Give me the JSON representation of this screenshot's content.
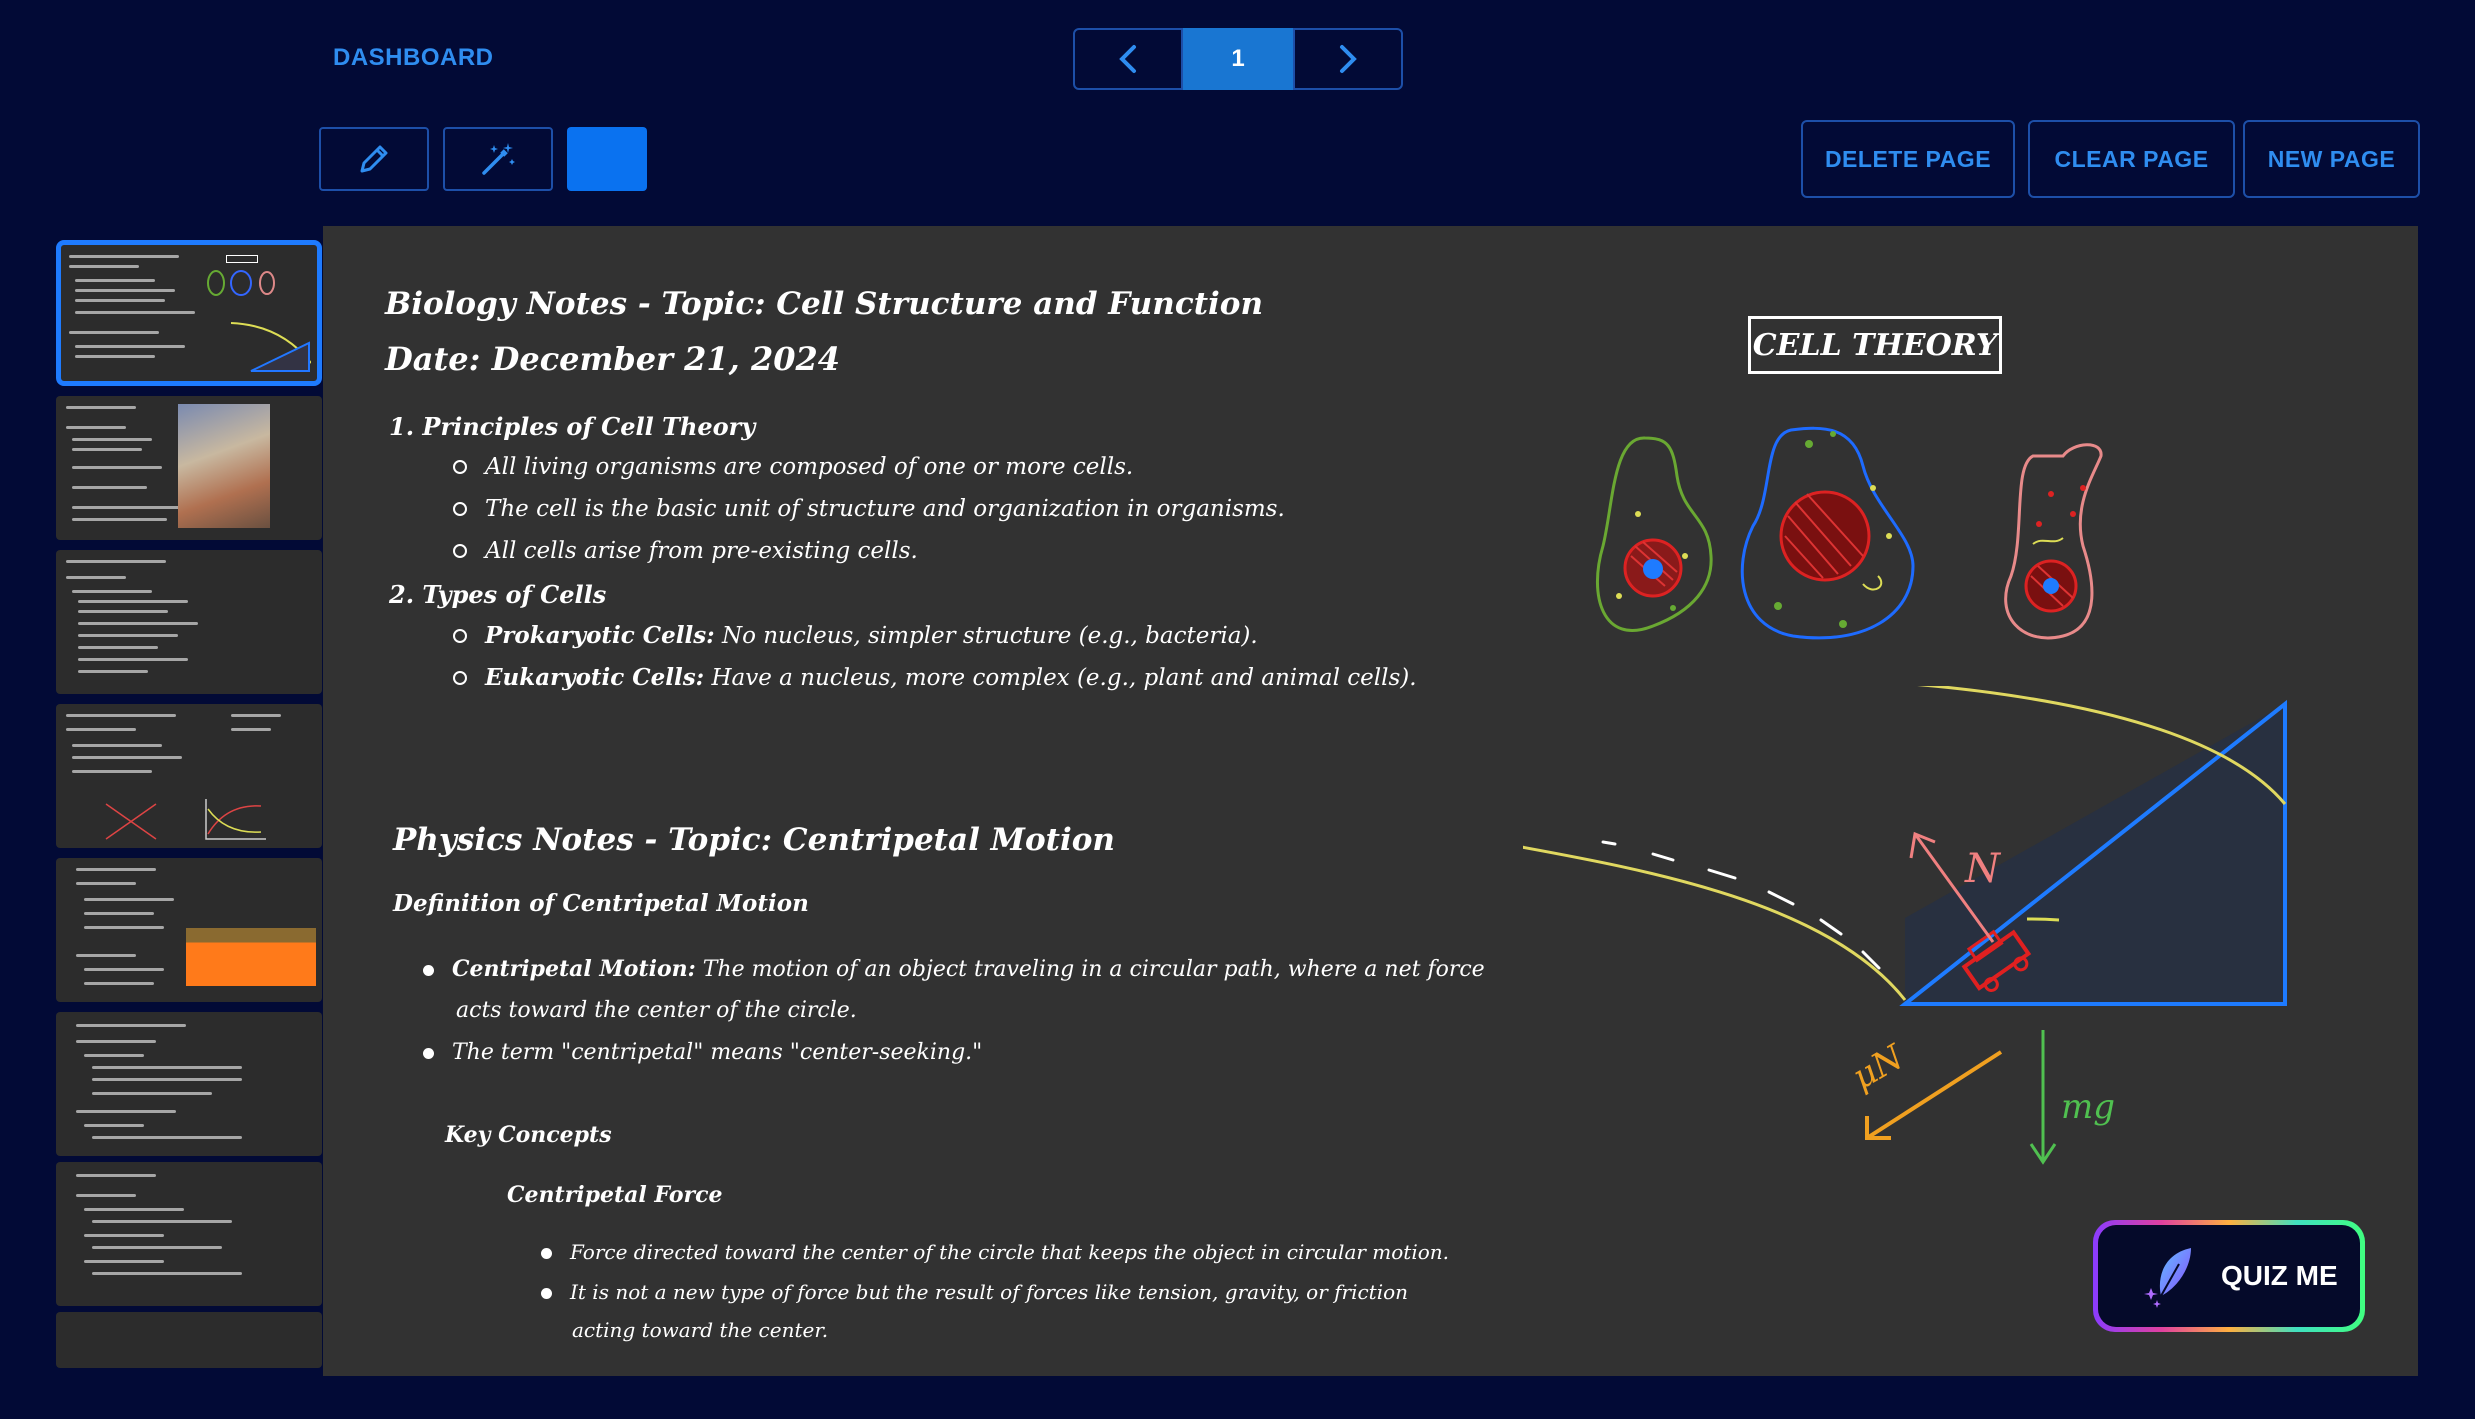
{
  "header": {
    "dashboard_label": "DASHBOARD",
    "page_number": "1"
  },
  "toolbar": {
    "swatch_color": "#0a72f0",
    "delete_page": "DELETE PAGE",
    "clear_page": "CLEAR PAGE",
    "new_page": "NEW PAGE"
  },
  "thumbnails": {
    "count": 8,
    "selected_index": 0
  },
  "biology": {
    "title": "Biology Notes - Topic: Cell Structure and Function",
    "date": "Date: December 21, 2024",
    "section1_heading": "1.  Principles of Cell Theory",
    "section1_items": [
      "All living organisms are composed of one or more cells.",
      "The cell is the basic unit of structure and organization in organisms.",
      "All cells arise from pre-existing cells."
    ],
    "section2_heading": "2.  Types of Cells",
    "prok_label": "Prokaryotic Cells:",
    "prok_text": " No nucleus, simpler structure (e.g., bacteria).",
    "euk_label": "Eukaryotic Cells:",
    "euk_text": " Have a nucleus, more complex (e.g., plant and animal cells).",
    "cell_theory_label": "CELL THEORY"
  },
  "physics": {
    "title": "Physics Notes - Topic: Centripetal Motion",
    "definition_heading": "Definition of Centripetal Motion",
    "cm_label": "Centripetal Motion:",
    "cm_text_1": " The motion of an object traveling in a circular path, where a net force",
    "cm_text_2": "acts toward the center of the circle.",
    "term_text": "The term \"centripetal\" means \"center-seeking.\"",
    "key_concepts": "Key Concepts",
    "cf_heading": "Centripetal Force",
    "cf_items": [
      "Force directed toward the center of the circle that keeps the object in circular motion.",
      "It is not a new type of force but the result of forces like tension, gravity, or friction"
    ],
    "cf_item2_cont": "acting toward the center.",
    "diagram_labels": {
      "normal": "N",
      "friction": "μN",
      "weight": "mg"
    }
  },
  "quiz": {
    "label": "QUIZ ME"
  }
}
